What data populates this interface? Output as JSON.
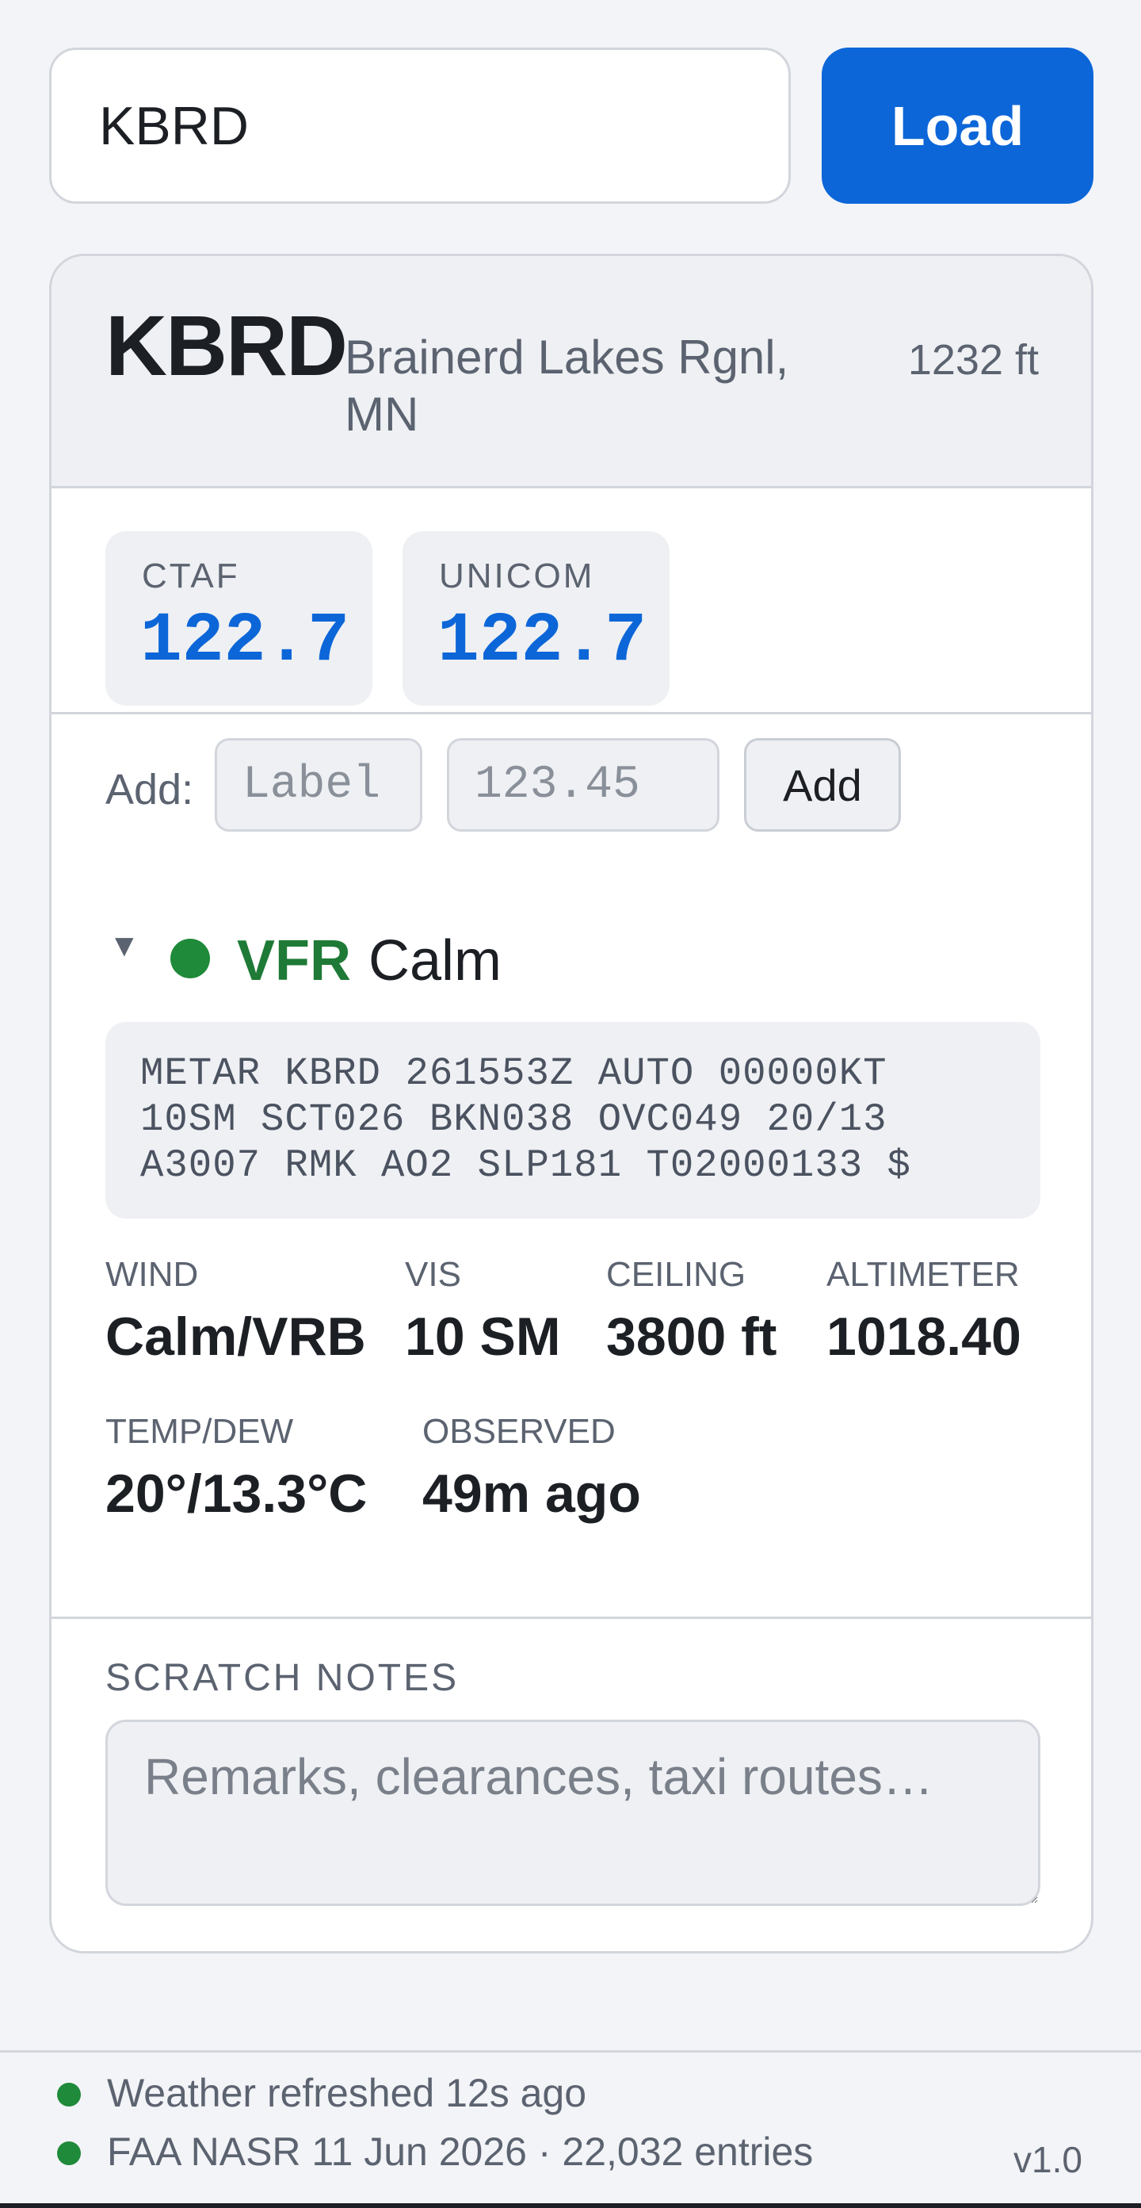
{
  "search": {
    "value": "KBRD",
    "button_label": "Load"
  },
  "airport": {
    "ident": "KBRD",
    "name": "Brainerd Lakes Rgnl, MN",
    "elevation": "1232 ft"
  },
  "frequencies": [
    {
      "label": "CTAF",
      "value": "122.7"
    },
    {
      "label": "UNICOM",
      "value": "122.7"
    }
  ],
  "add_freq": {
    "label": "Add:",
    "label_placeholder": "Label",
    "freq_placeholder": "123.45",
    "button_label": "Add"
  },
  "weather": {
    "caret": "▼",
    "category": "VFR",
    "category_color": "#1e8a3a",
    "wind_summary": "Calm",
    "metar": "METAR KBRD 261553Z AUTO 00000KT 10SM SCT026 BKN038 OVC049 20/13 A3007 RMK AO2 SLP181 T02000133 $",
    "stats": [
      {
        "label": "WIND",
        "value": "Calm/VRB"
      },
      {
        "label": "VIS",
        "value": "10 SM"
      },
      {
        "label": "CEILING",
        "value": "3800 ft"
      },
      {
        "label": "ALTIMETER",
        "value": "1018.40"
      },
      {
        "label": "TEMP/DEW",
        "value": "20°/13.3°C"
      },
      {
        "label": "OBSERVED",
        "value": "49m ago"
      }
    ]
  },
  "notes": {
    "label": "SCRATCH NOTES",
    "placeholder": "Remarks, clearances, taxi routes…"
  },
  "footer": {
    "status_1": "Weather refreshed 12s ago",
    "status_2": "FAA NASR 11 Jun 2026 · 22,032 entries",
    "version": "v1.0"
  },
  "colors": {
    "accent": "#0c66d8",
    "vfr_green": "#1e8a3a"
  }
}
